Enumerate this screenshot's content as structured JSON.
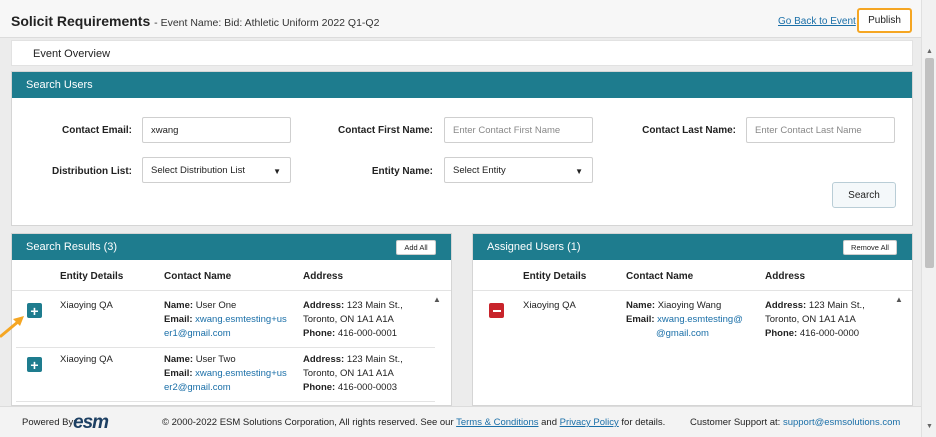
{
  "header": {
    "title": "Solicit Requirements",
    "subtitle": "- Event Name: Bid: Athletic Uniform 2022 Q1-Q2",
    "back_link": "Go Back to Event",
    "publish_label": "Publish"
  },
  "tabs": {
    "event_overview": "Event Overview"
  },
  "search_users": {
    "title": "Search Users",
    "contact_email_label": "Contact Email:",
    "contact_email_value": "xwang",
    "first_name_label": "Contact First Name:",
    "first_name_placeholder": "Enter Contact First Name",
    "last_name_label": "Contact Last Name:",
    "last_name_placeholder": "Enter Contact Last Name",
    "distribution_label": "Distribution List:",
    "distribution_value": "Select Distribution List",
    "entity_label": "Entity Name:",
    "entity_value": "Select Entity",
    "search_button": "Search"
  },
  "search_results": {
    "title": "Search Results (3)",
    "add_all": "Add All",
    "columns": [
      "Entity Details",
      "Contact Name",
      "Address"
    ],
    "rows": [
      {
        "entity": "Xiaoying QA",
        "name_label": "Name:",
        "name": "User One",
        "email_label": "Email:",
        "email_line1": "xwang.esmtesting+us",
        "email_line2": "er1@gmail.com",
        "address_label": "Address:",
        "address_line1": "123 Main St.,",
        "address_line2": "Toronto, ON 1A1 A1A",
        "phone_label": "Phone:",
        "phone": "416-000-0001"
      },
      {
        "entity": "Xiaoying QA",
        "name_label": "Name:",
        "name": "User Two",
        "email_label": "Email:",
        "email_line1": "xwang.esmtesting+us",
        "email_line2": "er2@gmail.com",
        "address_label": "Address:",
        "address_line1": "123 Main St.,",
        "address_line2": "Toronto, ON 1A1 A1A",
        "phone_label": "Phone:",
        "phone": "416-000-0003"
      }
    ]
  },
  "assigned_users": {
    "title": "Assigned Users (1)",
    "remove_all": "Remove All",
    "columns": [
      "Entity Details",
      "Contact Name",
      "Address"
    ],
    "rows": [
      {
        "entity": "Xiaoying QA",
        "name_label": "Name:",
        "name": "Xiaoying Wang",
        "email_label": "Email:",
        "email_line1": "xwang.esmtesting@",
        "email_line2": "@gmail.com",
        "address_label": "Address:",
        "address_line1": "123 Main St.,",
        "address_line2": "Toronto, ON 1A1 A1A",
        "phone_label": "Phone:",
        "phone": "416-000-0000"
      }
    ]
  },
  "footer": {
    "powered_by": "Powered By:",
    "logo_text": "esm",
    "copyright": "© 2000-2022 ESM Solutions Corporation, All rights reserved. See our",
    "terms": "Terms & Conditions",
    "and": "and",
    "privacy": "Privacy Policy",
    "details": "for details.",
    "support_label": "Customer Support at:",
    "support_email": "support@esmsolutions.com"
  },
  "colors": {
    "panel_header": "#1e7c8e",
    "accent_orange": "#f5a623",
    "link_blue": "#1a6fa8",
    "remove_red": "#c8242b"
  }
}
